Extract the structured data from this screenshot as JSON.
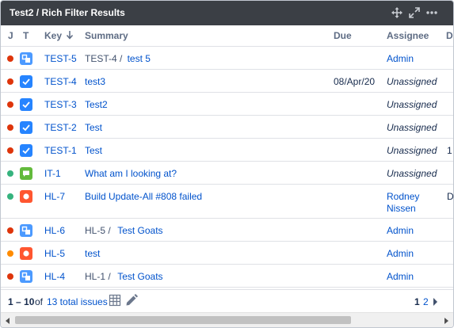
{
  "gadget": {
    "title": "Test2 / Rich Filter Results"
  },
  "columns": {
    "j": "J",
    "t": "T",
    "key": "Key",
    "summary": "Summary",
    "due": "Due",
    "assignee": "Assignee",
    "d": "D"
  },
  "colors": {
    "header_bg": "#3b3f45",
    "link": "#0052cc",
    "status_red": "#de350b",
    "status_green": "#36b37e",
    "status_orange": "#ff8b00",
    "type_blue": "#2684ff",
    "type_subtask": "#4c9aff",
    "type_green": "#63ba3c",
    "type_red": "#ff5630"
  },
  "rows": [
    {
      "status_color": "red",
      "type_icon": "subtask-icon",
      "key": "TEST-5",
      "parent": "TEST-4 /",
      "summary": "test 5",
      "due": "",
      "assignee": "Admin",
      "assignee_italic": false,
      "extra": ""
    },
    {
      "status_color": "red",
      "type_icon": "task-icon",
      "key": "TEST-4",
      "parent": "",
      "summary": "test3",
      "due": "08/Apr/20",
      "assignee": "Unassigned",
      "assignee_italic": true,
      "extra": ""
    },
    {
      "status_color": "red",
      "type_icon": "task-icon",
      "key": "TEST-3",
      "parent": "",
      "summary": "Test2",
      "due": "",
      "assignee": "Unassigned",
      "assignee_italic": true,
      "extra": ""
    },
    {
      "status_color": "red",
      "type_icon": "task-icon",
      "key": "TEST-2",
      "parent": "",
      "summary": "Test",
      "due": "",
      "assignee": "Unassigned",
      "assignee_italic": true,
      "extra": ""
    },
    {
      "status_color": "red",
      "type_icon": "task-icon",
      "key": "TEST-1",
      "parent": "",
      "summary": "Test",
      "due": "",
      "assignee": "Unassigned",
      "assignee_italic": true,
      "extra": "1"
    },
    {
      "status_color": "green",
      "type_icon": "feedback-icon",
      "key": "IT-1",
      "parent": "",
      "summary": "What am I looking at?",
      "due": "",
      "assignee": "Unassigned",
      "assignee_italic": true,
      "extra": ""
    },
    {
      "status_color": "green",
      "type_icon": "bug-icon",
      "key": "HL-7",
      "parent": "",
      "summary": "Build Update-All #808 failed",
      "due": "",
      "assignee": "Rodney",
      "assignee2": "Nissen",
      "assignee_italic": false,
      "extra": "D"
    },
    {
      "status_color": "red",
      "type_icon": "subtask-icon",
      "key": "HL-6",
      "parent": "HL-5 /",
      "summary": "Test Goats",
      "due": "",
      "assignee": "Admin",
      "assignee_italic": false,
      "extra": ""
    },
    {
      "status_color": "orange",
      "type_icon": "bug-icon",
      "key": "HL-5",
      "parent": "",
      "summary": "test",
      "due": "",
      "assignee": "Admin",
      "assignee_italic": false,
      "extra": ""
    },
    {
      "status_color": "red",
      "type_icon": "subtask-icon",
      "key": "HL-4",
      "parent": "HL-1 /",
      "summary": "Test Goats",
      "due": "",
      "assignee": "Admin",
      "assignee_italic": false,
      "extra": ""
    }
  ],
  "footer": {
    "range": "1 – 10",
    "of": "of",
    "total": "13 total issues",
    "page_current": "1",
    "page_next": "2"
  },
  "icons": {
    "move": "move-icon",
    "expand": "expand-icon",
    "more": "more-icon",
    "sort": "arrow-down-icon",
    "table_view": "table-icon",
    "edit": "pencil-icon",
    "next_page": "caret-right-icon"
  }
}
